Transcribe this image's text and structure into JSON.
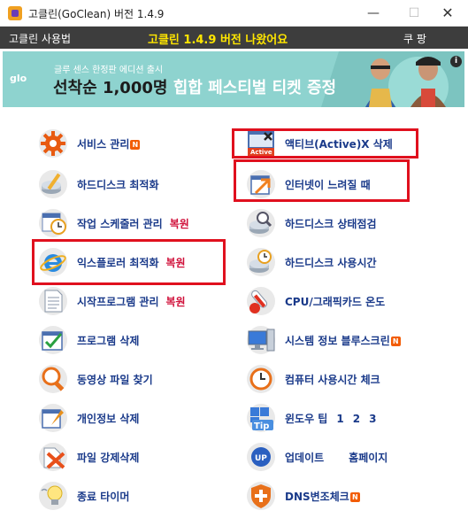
{
  "window": {
    "title": "고클린(GoClean) 버전 1.4.9",
    "min": "—",
    "max": "☐",
    "close": "✕"
  },
  "menubar": {
    "howto": "고클린 사용법",
    "news": "고클린 1.4.9 버전 나왔어요",
    "coupang": "쿠 팡"
  },
  "banner": {
    "brand": "glo",
    "sub": "글루 센스 한정판 에디션 출시",
    "main_dark": "선착순 1,000명",
    "main_light": " 힙합 페스티벌 티켓 증정"
  },
  "left": [
    {
      "label": "서비스 관리",
      "badge": "N",
      "icon": "gear-icon"
    },
    {
      "label": "하드디스크 최적화",
      "icon": "disk-wrench-icon"
    },
    {
      "label": "작업 스케줄러 관리",
      "restore": "복원",
      "icon": "calendar-clock-icon"
    },
    {
      "label": "익스플로러 최적화",
      "restore": "복원",
      "icon": "ie-icon"
    },
    {
      "label": "시작프로그램 관리",
      "restore": "복원",
      "icon": "document-icon"
    },
    {
      "label": "프로그램 삭제",
      "icon": "program-check-icon"
    },
    {
      "label": "동영상 파일 찾기",
      "icon": "magnifier-icon"
    },
    {
      "label": "개인정보 삭제",
      "icon": "privacy-icon"
    },
    {
      "label": "파일 강제삭제",
      "icon": "delete-x-icon"
    },
    {
      "label": "종료 타이머",
      "icon": "bulb-icon"
    }
  ],
  "right": [
    {
      "label": "액티브(Active)X 삭제",
      "icon": "activex-icon"
    },
    {
      "label": "인터넷이 느려질 때",
      "icon": "internet-arrow-icon"
    },
    {
      "label": "하드디스크 상태점검",
      "icon": "disk-search-icon"
    },
    {
      "label": "하드디스크 사용시간",
      "icon": "disk-clock-icon"
    },
    {
      "label": "CPU/그래픽카드 온도",
      "icon": "thermometer-icon"
    },
    {
      "label": "시스템 정보  블루스크린",
      "badge": "N",
      "icon": "computer-icon"
    },
    {
      "label": "컴퓨터 사용시간 체크",
      "icon": "clock-icon"
    },
    {
      "label": "윈도우 팁",
      "tips": [
        "1",
        "2",
        "3"
      ],
      "icon": "tip-icon"
    },
    {
      "label": "업데이트",
      "extra": "홈페이지",
      "icon": "update-icon"
    },
    {
      "label": "DNS변조체크",
      "badge": "N",
      "icon": "shield-icon"
    }
  ],
  "colors": {
    "label": "#1a3a8a",
    "restore": "#d0103a",
    "highlight": "#e0101e",
    "menubar": "#3d3d3d",
    "news": "#ffe600",
    "banner": "#8ed3cf",
    "badge": "#f25c05"
  }
}
